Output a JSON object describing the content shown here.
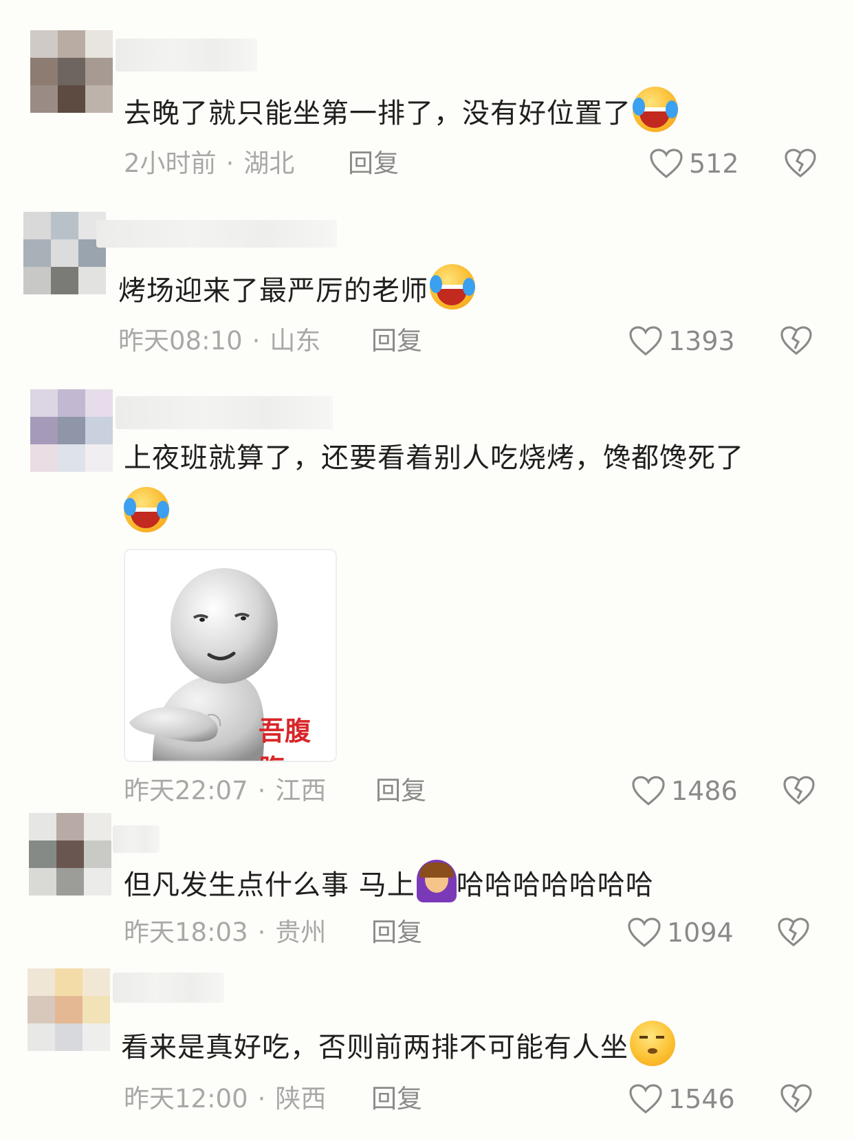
{
  "colors": {
    "background": "#fdfdf9",
    "text": "#1f1f1f",
    "meta": "#a8a8a8",
    "action": "#8a8a8a",
    "sticker_caption": "#d8262a"
  },
  "comments": [
    {
      "text": "去晚了就只能坐第一排了，没有好位置了",
      "emoji": "laughing-crying-emoji",
      "time": "2小时前",
      "location": "湖北",
      "reply": "回复",
      "likes": "512"
    },
    {
      "text": "烤场迎来了最严厉的老师",
      "emoji": "laughing-crying-emoji",
      "time": "昨天08:10",
      "location": "山东",
      "reply": "回复",
      "likes": "1393"
    },
    {
      "text": "上夜班就算了，还要看着别人吃烧烤，馋都馋死了",
      "emoji": "laughing-crying-emoji",
      "sticker_caption": "吾腹腹",
      "time": "昨天22:07",
      "location": "江西",
      "reply": "回复",
      "likes": "1486"
    },
    {
      "text_before": "但凡发生点什么事 马上",
      "emoji": "facepalm-emoji",
      "text_after": "哈哈哈哈哈哈哈",
      "time": "昨天18:03",
      "location": "贵州",
      "reply": "回复",
      "likes": "1094"
    },
    {
      "text": "看来是真好吃，否则前两排不可能有人坐",
      "emoji": "smug-emoji",
      "time": "昨天12:00",
      "location": "陕西",
      "reply": "回复",
      "likes": "1546"
    }
  ]
}
